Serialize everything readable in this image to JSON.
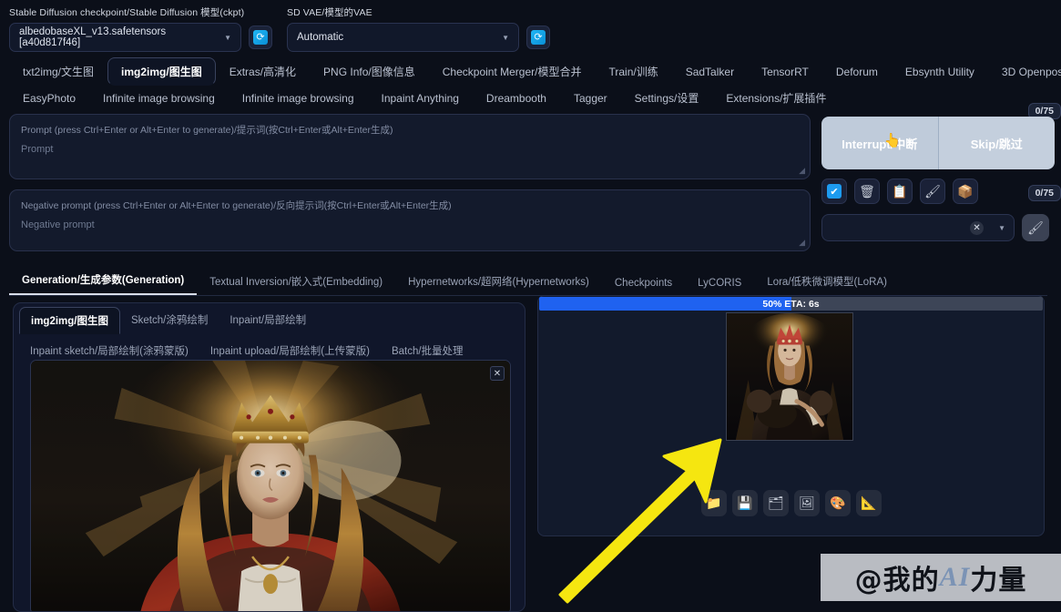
{
  "model_bar": {
    "checkpoint": {
      "label": "Stable Diffusion checkpoint/Stable Diffusion 模型(ckpt)",
      "value": "albedobaseXL_v13.safetensors [a40d817f46]",
      "caret": "▼",
      "refresh_icon": "refresh-icon",
      "refresh_glyph": "⟳"
    },
    "vae": {
      "label": "SD VAE/模型的VAE",
      "value": "Automatic",
      "caret": "▼",
      "refresh_icon": "refresh-icon",
      "refresh_glyph": "⟳"
    }
  },
  "nav_tabs_row1": [
    {
      "label": "txt2img/文生图",
      "active": false
    },
    {
      "label": "img2img/图生图",
      "active": true
    },
    {
      "label": "Extras/高清化",
      "active": false
    },
    {
      "label": "PNG Info/图像信息",
      "active": false
    },
    {
      "label": "Checkpoint Merger/模型合并",
      "active": false
    },
    {
      "label": "Train/训练",
      "active": false
    },
    {
      "label": "SadTalker",
      "active": false
    },
    {
      "label": "TensorRT",
      "active": false
    },
    {
      "label": "Deforum",
      "active": false
    },
    {
      "label": "Ebsynth Utility",
      "active": false
    },
    {
      "label": "3D Openpose",
      "active": false
    }
  ],
  "nav_tabs_row2": [
    {
      "label": "EasyPhoto",
      "active": false
    },
    {
      "label": "Infinite image browsing",
      "active": false
    },
    {
      "label": "Infinite image browsing",
      "active": false
    },
    {
      "label": "Inpaint Anything",
      "active": false
    },
    {
      "label": "Dreambooth",
      "active": false
    },
    {
      "label": "Tagger",
      "active": false
    },
    {
      "label": "Settings/设置",
      "active": false
    },
    {
      "label": "Extensions/扩展插件",
      "active": false
    }
  ],
  "prompt": {
    "placeholder_line1": "Prompt (press Ctrl+Enter or Alt+Enter to generate)/提示词(按Ctrl+Enter或Alt+Enter生成)",
    "placeholder_line2": "Prompt",
    "value": "",
    "token_count": "0/75",
    "resize_grip": "◢"
  },
  "negative_prompt": {
    "placeholder_line1": "Negative prompt (press Ctrl+Enter or Alt+Enter to generate)/反向提示词(按Ctrl+Enter或Alt+Enter生成)",
    "placeholder_line2": "Negative prompt",
    "value": "",
    "token_count": "0/75",
    "resize_grip": "◢"
  },
  "actions": {
    "interrupt_label": "Interrupt/中断",
    "skip_label": "Skip/跳过",
    "cursor_glyph": "👆",
    "quick_icons": [
      {
        "name": "checkbox-icon",
        "glyph": "✔"
      },
      {
        "name": "trash-icon",
        "glyph": "🗑"
      },
      {
        "name": "clipboard-icon",
        "glyph": "📋"
      },
      {
        "name": "brush-icon",
        "glyph": "🖌"
      },
      {
        "name": "package-icon",
        "glyph": "📦"
      }
    ],
    "styles_dropdown": {
      "value": "",
      "clear_glyph": "✕",
      "caret": "▼"
    },
    "paint_button_icon": "paintbrush-icon",
    "paint_button_glyph": "🖌"
  },
  "generation_tabs": [
    {
      "label": "Generation/生成参数(Generation)",
      "active": true
    },
    {
      "label": "Textual Inversion/嵌入式(Embedding)",
      "active": false
    },
    {
      "label": "Hypernetworks/超网络(Hypernetworks)",
      "active": false
    },
    {
      "label": "Checkpoints",
      "active": false
    },
    {
      "label": "LyCORIS",
      "active": false
    },
    {
      "label": "Lora/低秩微调模型(LoRA)",
      "active": false
    }
  ],
  "img2img_tabs_row1": [
    {
      "label": "img2img/图生图",
      "active": true
    },
    {
      "label": "Sketch/涂鸦绘制",
      "active": false
    },
    {
      "label": "Inpaint/局部绘制",
      "active": false
    }
  ],
  "img2img_tabs_row2": [
    {
      "label": "Inpaint sketch/局部绘制(涂鸦蒙版)",
      "active": false
    },
    {
      "label": "Inpaint upload/局部绘制(上传蒙版)",
      "active": false
    },
    {
      "label": "Batch/批量处理",
      "active": false
    }
  ],
  "source_image": {
    "name": "queen-portrait-source",
    "close_glyph": "✕",
    "description": "Painted portrait of a young queen with a golden jeweled crown, backlit golden light rays, long wavy auburn hair, red and gold embroidered robe with white lace"
  },
  "output": {
    "progress": {
      "text": "50% ETA: 6s",
      "percent": 50,
      "fill_color": "#1f62f0",
      "track_color": "#3d4557"
    },
    "preview_description": "Medieval painted portrait of a crowned woman seated, red and gold crown, golden halo glow, dark background",
    "toolbar_icons": [
      {
        "name": "folder-icon",
        "glyph": "📁"
      },
      {
        "name": "save-icon",
        "glyph": "💾"
      },
      {
        "name": "save-zip-icon",
        "glyph": "🗂"
      },
      {
        "name": "send-to-img2img-icon",
        "glyph": "🖼"
      },
      {
        "name": "send-to-inpaint-icon",
        "glyph": "🎨"
      },
      {
        "name": "send-to-extras-icon",
        "glyph": "📐"
      }
    ]
  },
  "annotation": {
    "arrow_color": "#f5e610",
    "arrow_name": "pointer-arrow"
  },
  "watermark": {
    "prefix": "@我的",
    "ai": "AI",
    "suffix": "力量"
  },
  "colors": {
    "background": "#0b0f19",
    "panel": "#121a2c",
    "border": "#242d47",
    "accent_blue": "#1f62f0",
    "button_light": "#c2cedd"
  }
}
